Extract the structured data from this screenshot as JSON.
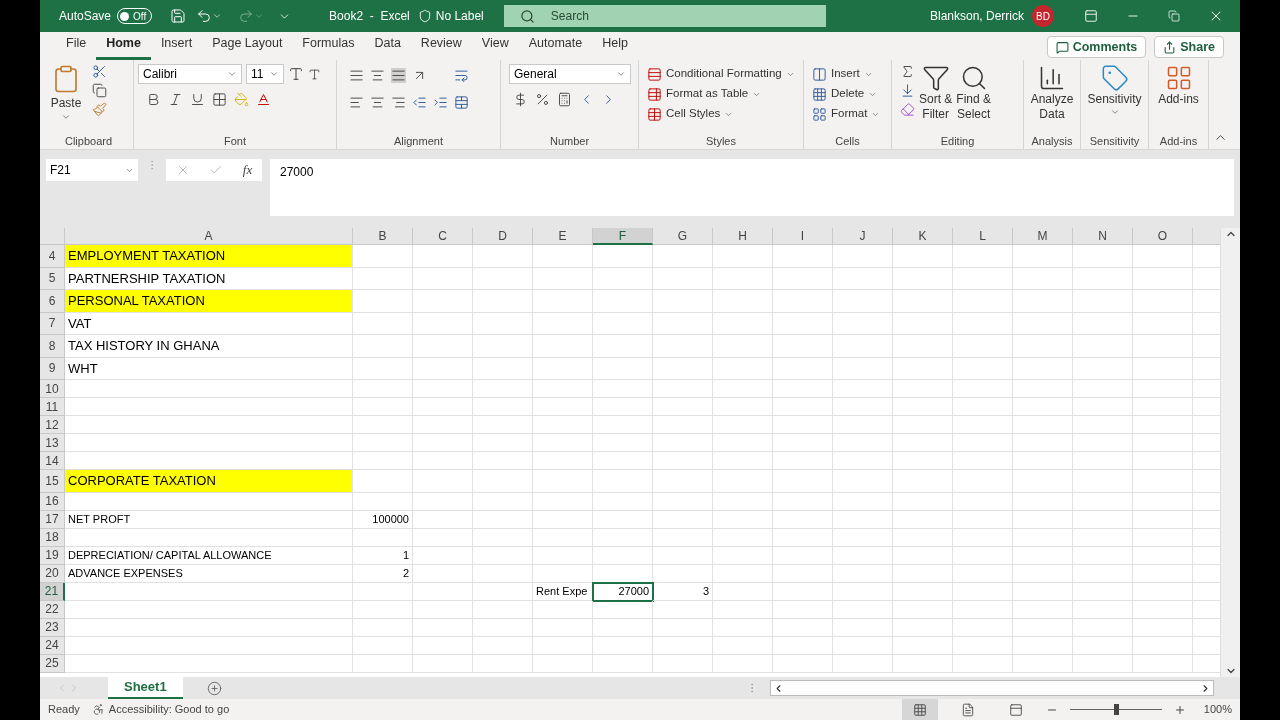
{
  "title_bar": {
    "autosave": {
      "label": "AutoSave",
      "on": false,
      "state_text": "Off"
    },
    "document": "Book2  -  Excel",
    "sensitivity_label": "No Label",
    "search": {
      "placeholder": "Search"
    },
    "user": "Blankson, Derrick",
    "avatar": "BD"
  },
  "menu_tabs": [
    {
      "label": "File",
      "selected": false
    },
    {
      "label": "Home",
      "selected": true
    },
    {
      "label": "Insert",
      "selected": false
    },
    {
      "label": "Page Layout",
      "selected": false
    },
    {
      "label": "Formulas",
      "selected": false
    },
    {
      "label": "Data",
      "selected": false
    },
    {
      "label": "Review",
      "selected": false
    },
    {
      "label": "View",
      "selected": false
    },
    {
      "label": "Automate",
      "selected": false
    },
    {
      "label": "Help",
      "selected": false
    }
  ],
  "header_buttons": {
    "comments": "Comments",
    "share": "Share"
  },
  "ribbon": {
    "clipboard": {
      "label": "Clipboard",
      "paste": "Paste"
    },
    "font": {
      "label": "Font",
      "name": "Calibri",
      "size": "11"
    },
    "alignment": {
      "label": "Alignment"
    },
    "number": {
      "label": "Number",
      "format": "General"
    },
    "styles": {
      "label": "Styles",
      "items": [
        "Conditional Formatting",
        "Format as Table",
        "Cell Styles"
      ]
    },
    "cells": {
      "label": "Cells",
      "items": [
        "Insert",
        "Delete",
        "Format"
      ]
    },
    "editing": {
      "label": "Editing",
      "sort": [
        "Sort &",
        "Filter"
      ],
      "find": [
        "Find &",
        "Select"
      ]
    },
    "analysis": {
      "label": "Analysis",
      "button": [
        "Analyze",
        "Data"
      ]
    },
    "sensitivity": {
      "label": "Sensitivity",
      "button": "Sensitivity"
    },
    "addins": {
      "label": "Add-ins",
      "button": "Add-ins"
    }
  },
  "formula_bar": {
    "name_box": "F21",
    "function_label": "fx",
    "value": "27000"
  },
  "columns": [
    {
      "label": "A",
      "selected": false
    },
    {
      "label": "B",
      "selected": false
    },
    {
      "label": "C",
      "selected": false
    },
    {
      "label": "D",
      "selected": false
    },
    {
      "label": "E",
      "selected": false
    },
    {
      "label": "F",
      "selected": true
    },
    {
      "label": "G",
      "selected": false
    },
    {
      "label": "H",
      "selected": false
    },
    {
      "label": "I",
      "selected": false
    },
    {
      "label": "J",
      "selected": false
    },
    {
      "label": "K",
      "selected": false
    },
    {
      "label": "L",
      "selected": false
    },
    {
      "label": "M",
      "selected": false
    },
    {
      "label": "N",
      "selected": false
    },
    {
      "label": "O",
      "selected": false
    }
  ],
  "rows": [
    {
      "number": "4",
      "kind": "heading",
      "selected": false,
      "cells": {
        "A": {
          "text": "EMPLOYMENT TAXATION",
          "kind": "text",
          "highlight": true,
          "selected": false
        }
      }
    },
    {
      "number": "5",
      "kind": "heading",
      "selected": false,
      "cells": {
        "A": {
          "text": "PARTNERSHIP TAXATION",
          "kind": "text",
          "highlight": false,
          "selected": false
        }
      }
    },
    {
      "number": "6",
      "kind": "heading",
      "selected": false,
      "cells": {
        "A": {
          "text": "PERSONAL TAXATION",
          "kind": "text",
          "highlight": true,
          "selected": false
        }
      }
    },
    {
      "number": "7",
      "kind": "heading",
      "selected": false,
      "cells": {
        "A": {
          "text": "VAT",
          "kind": "text",
          "highlight": false,
          "selected": false
        }
      }
    },
    {
      "number": "8",
      "kind": "heading",
      "selected": false,
      "cells": {
        "A": {
          "text": "TAX HISTORY IN GHANA",
          "kind": "text",
          "highlight": false,
          "selected": false
        }
      }
    },
    {
      "number": "9",
      "kind": "heading",
      "selected": false,
      "cells": {
        "A": {
          "text": "WHT",
          "kind": "text",
          "highlight": false,
          "selected": false
        }
      }
    },
    {
      "number": "10",
      "kind": "normal",
      "selected": false
    },
    {
      "number": "11",
      "kind": "normal",
      "selected": false
    },
    {
      "number": "12",
      "kind": "normal",
      "selected": false
    },
    {
      "number": "13",
      "kind": "normal",
      "selected": false
    },
    {
      "number": "14",
      "kind": "normal",
      "selected": false
    },
    {
      "number": "15",
      "kind": "heading",
      "selected": false,
      "cells": {
        "A": {
          "text": "CORPORATE TAXATION",
          "kind": "text",
          "highlight": true,
          "selected": false
        }
      }
    },
    {
      "number": "16",
      "kind": "normal",
      "selected": false
    },
    {
      "number": "17",
      "kind": "normal",
      "selected": false,
      "cells": {
        "A": {
          "text": "NET PROFT",
          "kind": "text",
          "highlight": false,
          "selected": false
        },
        "B": {
          "text": "100000",
          "kind": "number",
          "highlight": false,
          "selected": false
        }
      }
    },
    {
      "number": "18",
      "kind": "normal",
      "selected": false
    },
    {
      "number": "19",
      "kind": "normal",
      "selected": false,
      "cells": {
        "A": {
          "text": "DEPRECIATION/ CAPITAL ALLOWANCE",
          "kind": "text",
          "highlight": false,
          "selected": false
        },
        "B": {
          "text": "1",
          "kind": "number",
          "highlight": false,
          "selected": false
        }
      }
    },
    {
      "number": "20",
      "kind": "normal",
      "selected": false,
      "cells": {
        "A": {
          "text": "ADVANCE EXPENSES",
          "kind": "text",
          "highlight": false,
          "selected": false
        },
        "B": {
          "text": "2",
          "kind": "number",
          "highlight": false,
          "selected": false
        }
      }
    },
    {
      "number": "21",
      "kind": "normal",
      "selected": true,
      "cells": {
        "E": {
          "text": "Rent Expe",
          "kind": "text",
          "highlight": false,
          "selected": false
        },
        "F": {
          "text": "27000",
          "kind": "number",
          "highlight": false,
          "selected": true
        },
        "G": {
          "text": "3",
          "kind": "number",
          "highlight": false,
          "selected": false
        }
      }
    },
    {
      "number": "22",
      "kind": "normal",
      "selected": false
    },
    {
      "number": "23",
      "kind": "normal",
      "selected": false
    },
    {
      "number": "24",
      "kind": "normal",
      "selected": false
    },
    {
      "number": "25",
      "kind": "normal",
      "selected": false
    }
  ],
  "sheet_tabs": [
    {
      "label": "Sheet1",
      "selected": true
    }
  ],
  "status_bar": {
    "status": "Ready",
    "accessibility": "Accessibility: Good to go",
    "views": [
      {
        "kind": "normal",
        "selected": true
      },
      {
        "kind": "page-layout",
        "selected": false
      },
      {
        "kind": "page-break",
        "selected": false
      }
    ],
    "zoom": {
      "level": 0.5
    },
    "zoom_text": "100%"
  }
}
